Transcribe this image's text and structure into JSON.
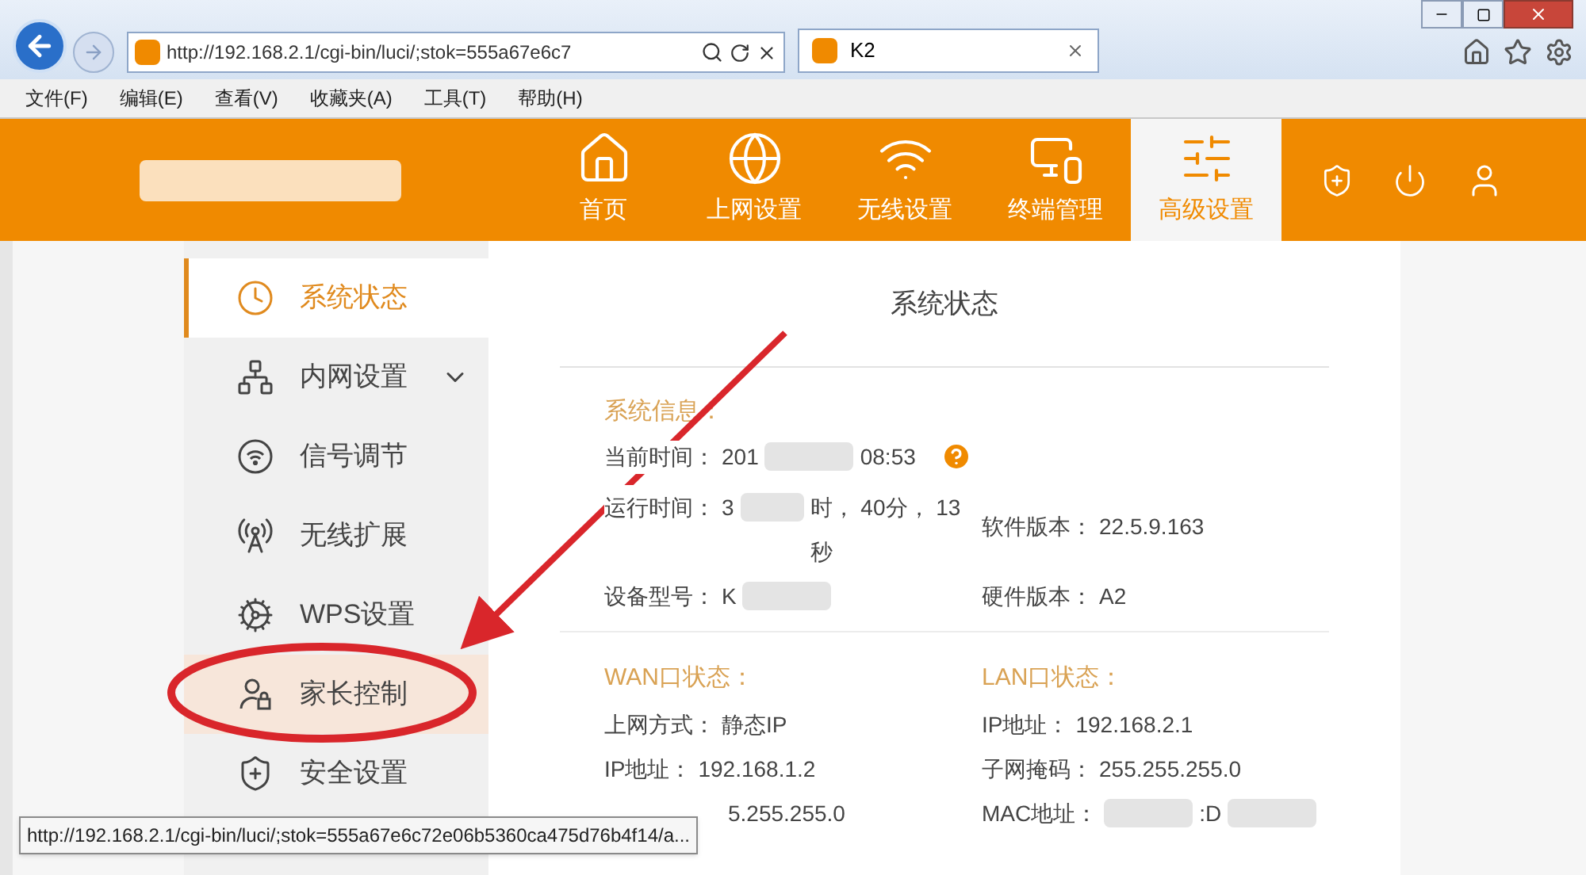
{
  "browser": {
    "address": "http://192.168.2.1/cgi-bin/luci/;stok=555a67e6c7",
    "tab": {
      "title": "K2",
      "selected": true
    },
    "menu": [
      "文件(F)",
      "编辑(E)",
      "查看(V)",
      "收藏夹(A)",
      "工具(T)",
      "帮助(H)"
    ]
  },
  "header": {
    "nav": [
      {
        "label": "首页",
        "kind": "home",
        "selected": false
      },
      {
        "label": "上网设置",
        "kind": "internet",
        "selected": false
      },
      {
        "label": "无线设置",
        "kind": "wireless",
        "selected": false
      },
      {
        "label": "终端管理",
        "kind": "devices",
        "selected": false
      },
      {
        "label": "高级设置",
        "kind": "advanced",
        "selected": true
      }
    ]
  },
  "sidebar": {
    "items": [
      {
        "label": "系统状态",
        "kind": "status",
        "selected": true,
        "hovered": false,
        "expandable": false
      },
      {
        "label": "内网设置",
        "kind": "lan",
        "selected": false,
        "hovered": false,
        "expandable": true
      },
      {
        "label": "信号调节",
        "kind": "signal",
        "selected": false,
        "hovered": false,
        "expandable": false
      },
      {
        "label": "无线扩展",
        "kind": "extend",
        "selected": false,
        "hovered": false,
        "expandable": false
      },
      {
        "label": "WPS设置",
        "kind": "wps",
        "selected": false,
        "hovered": false,
        "expandable": false
      },
      {
        "label": "家长控制",
        "kind": "parental",
        "selected": false,
        "hovered": true,
        "expandable": false
      },
      {
        "label": "安全设置",
        "kind": "security",
        "selected": false,
        "hovered": false,
        "expandable": false
      }
    ]
  },
  "content": {
    "title": "系统状态",
    "system_info": {
      "heading": "系统信息：",
      "time": {
        "label": "当前时间：",
        "help": true,
        "segments": [
          {
            "kind": "text",
            "text": "201"
          },
          {
            "kind": "redacted"
          },
          {
            "kind": "text",
            "text": "08:53"
          }
        ]
      },
      "uptime": {
        "label": "运行时间：",
        "segments": [
          {
            "kind": "text",
            "text": "3"
          },
          {
            "kind": "redacted"
          },
          {
            "kind": "text",
            "text": "时， 40分， 13 秒"
          }
        ]
      },
      "software": {
        "label": "软件版本：",
        "segments": [
          {
            "kind": "text",
            "text": "22.5.9.163"
          }
        ]
      },
      "model": {
        "label": "设备型号：",
        "segments": [
          {
            "kind": "text",
            "text": "K"
          },
          {
            "kind": "redacted"
          }
        ]
      },
      "hardware": {
        "label": "硬件版本：",
        "segments": [
          {
            "kind": "text",
            "text": "A2"
          }
        ]
      }
    },
    "wan": {
      "heading": "WAN口状态：",
      "rows": [
        {
          "label": "上网方式：",
          "segments": [
            {
              "kind": "text",
              "text": "静态IP"
            }
          ]
        },
        {
          "label": "IP地址：",
          "segments": [
            {
              "kind": "text",
              "text": "192.168.1.2"
            }
          ]
        },
        {
          "segments": [
            {
              "kind": "text",
              "text": "5.255.255.0"
            }
          ]
        }
      ]
    },
    "lan": {
      "heading": "LAN口状态：",
      "rows": [
        {
          "label": "IP地址：",
          "segments": [
            {
              "kind": "text",
              "text": "192.168.2.1"
            }
          ]
        },
        {
          "label": "子网掩码：",
          "segments": [
            {
              "kind": "text",
              "text": "255.255.255.0"
            }
          ]
        },
        {
          "label": "MAC地址：",
          "segments": [
            {
              "kind": "redacted"
            },
            {
              "kind": "text",
              "text": ":D"
            },
            {
              "kind": "redacted"
            }
          ]
        }
      ]
    }
  },
  "status_tooltip": "http://192.168.2.1/cgi-bin/luci/;stok=555a67e6c72e06b5360ca475d76b4f14/a..."
}
